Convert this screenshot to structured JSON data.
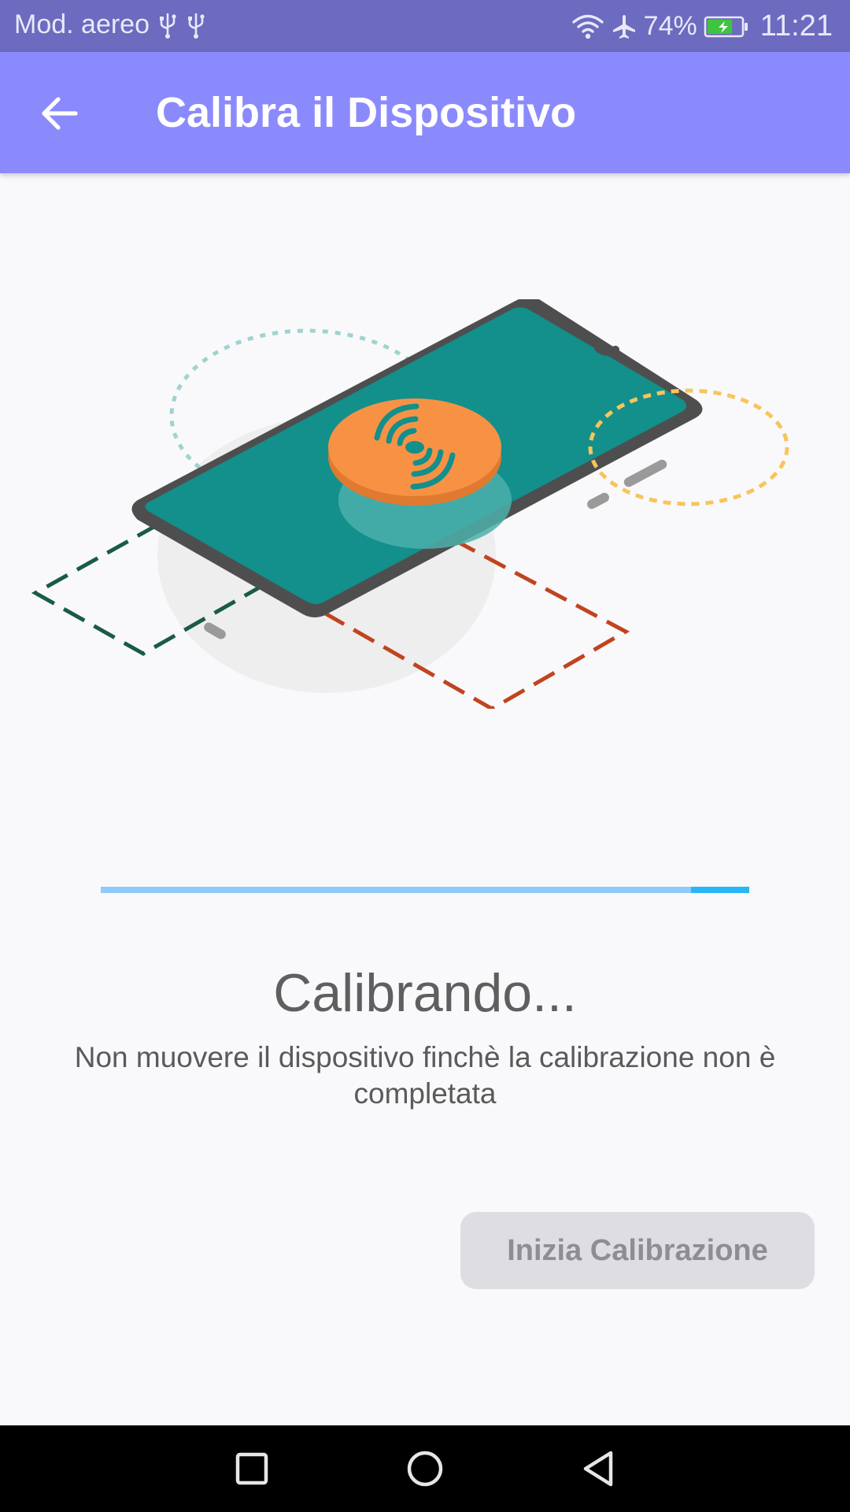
{
  "status_bar": {
    "carrier_text": "Mod. aereo",
    "battery_percent": "74%",
    "time": "11:21",
    "icons": [
      "usb-icon",
      "usb-icon",
      "wifi-icon",
      "airplane-icon",
      "battery-charging-icon"
    ],
    "battery_level": 0.74,
    "battery_color": "#3ec43e"
  },
  "app_bar": {
    "title": "Calibra il Dispositivo",
    "back_icon": "arrow-back-icon",
    "color": "#8b8afc"
  },
  "illustration": {
    "description_icon": "phone-calibration-illustration",
    "colors": {
      "phone_screen": "#138f8c",
      "phone_frame": "#4e4e4e",
      "nfc_tag": "#f79244",
      "green_dash": "#1a5a4a",
      "red_dash": "#c0441e",
      "yellow_dash": "#f7c55c",
      "teal_dots": "#9fd3cf"
    }
  },
  "progress": {
    "value": 0.91,
    "track_color": "#90caf9",
    "fill_color": "#29b6f6"
  },
  "calibration": {
    "title": "Calibrando...",
    "message": "Non muovere il dispositivo finchè la calibrazione non è completata"
  },
  "button": {
    "label": "Inizia Calibrazione",
    "enabled": false
  },
  "nav_bar": {
    "recents_icon": "square-icon",
    "home_icon": "circle-icon",
    "back_icon": "triangle-back-icon"
  }
}
